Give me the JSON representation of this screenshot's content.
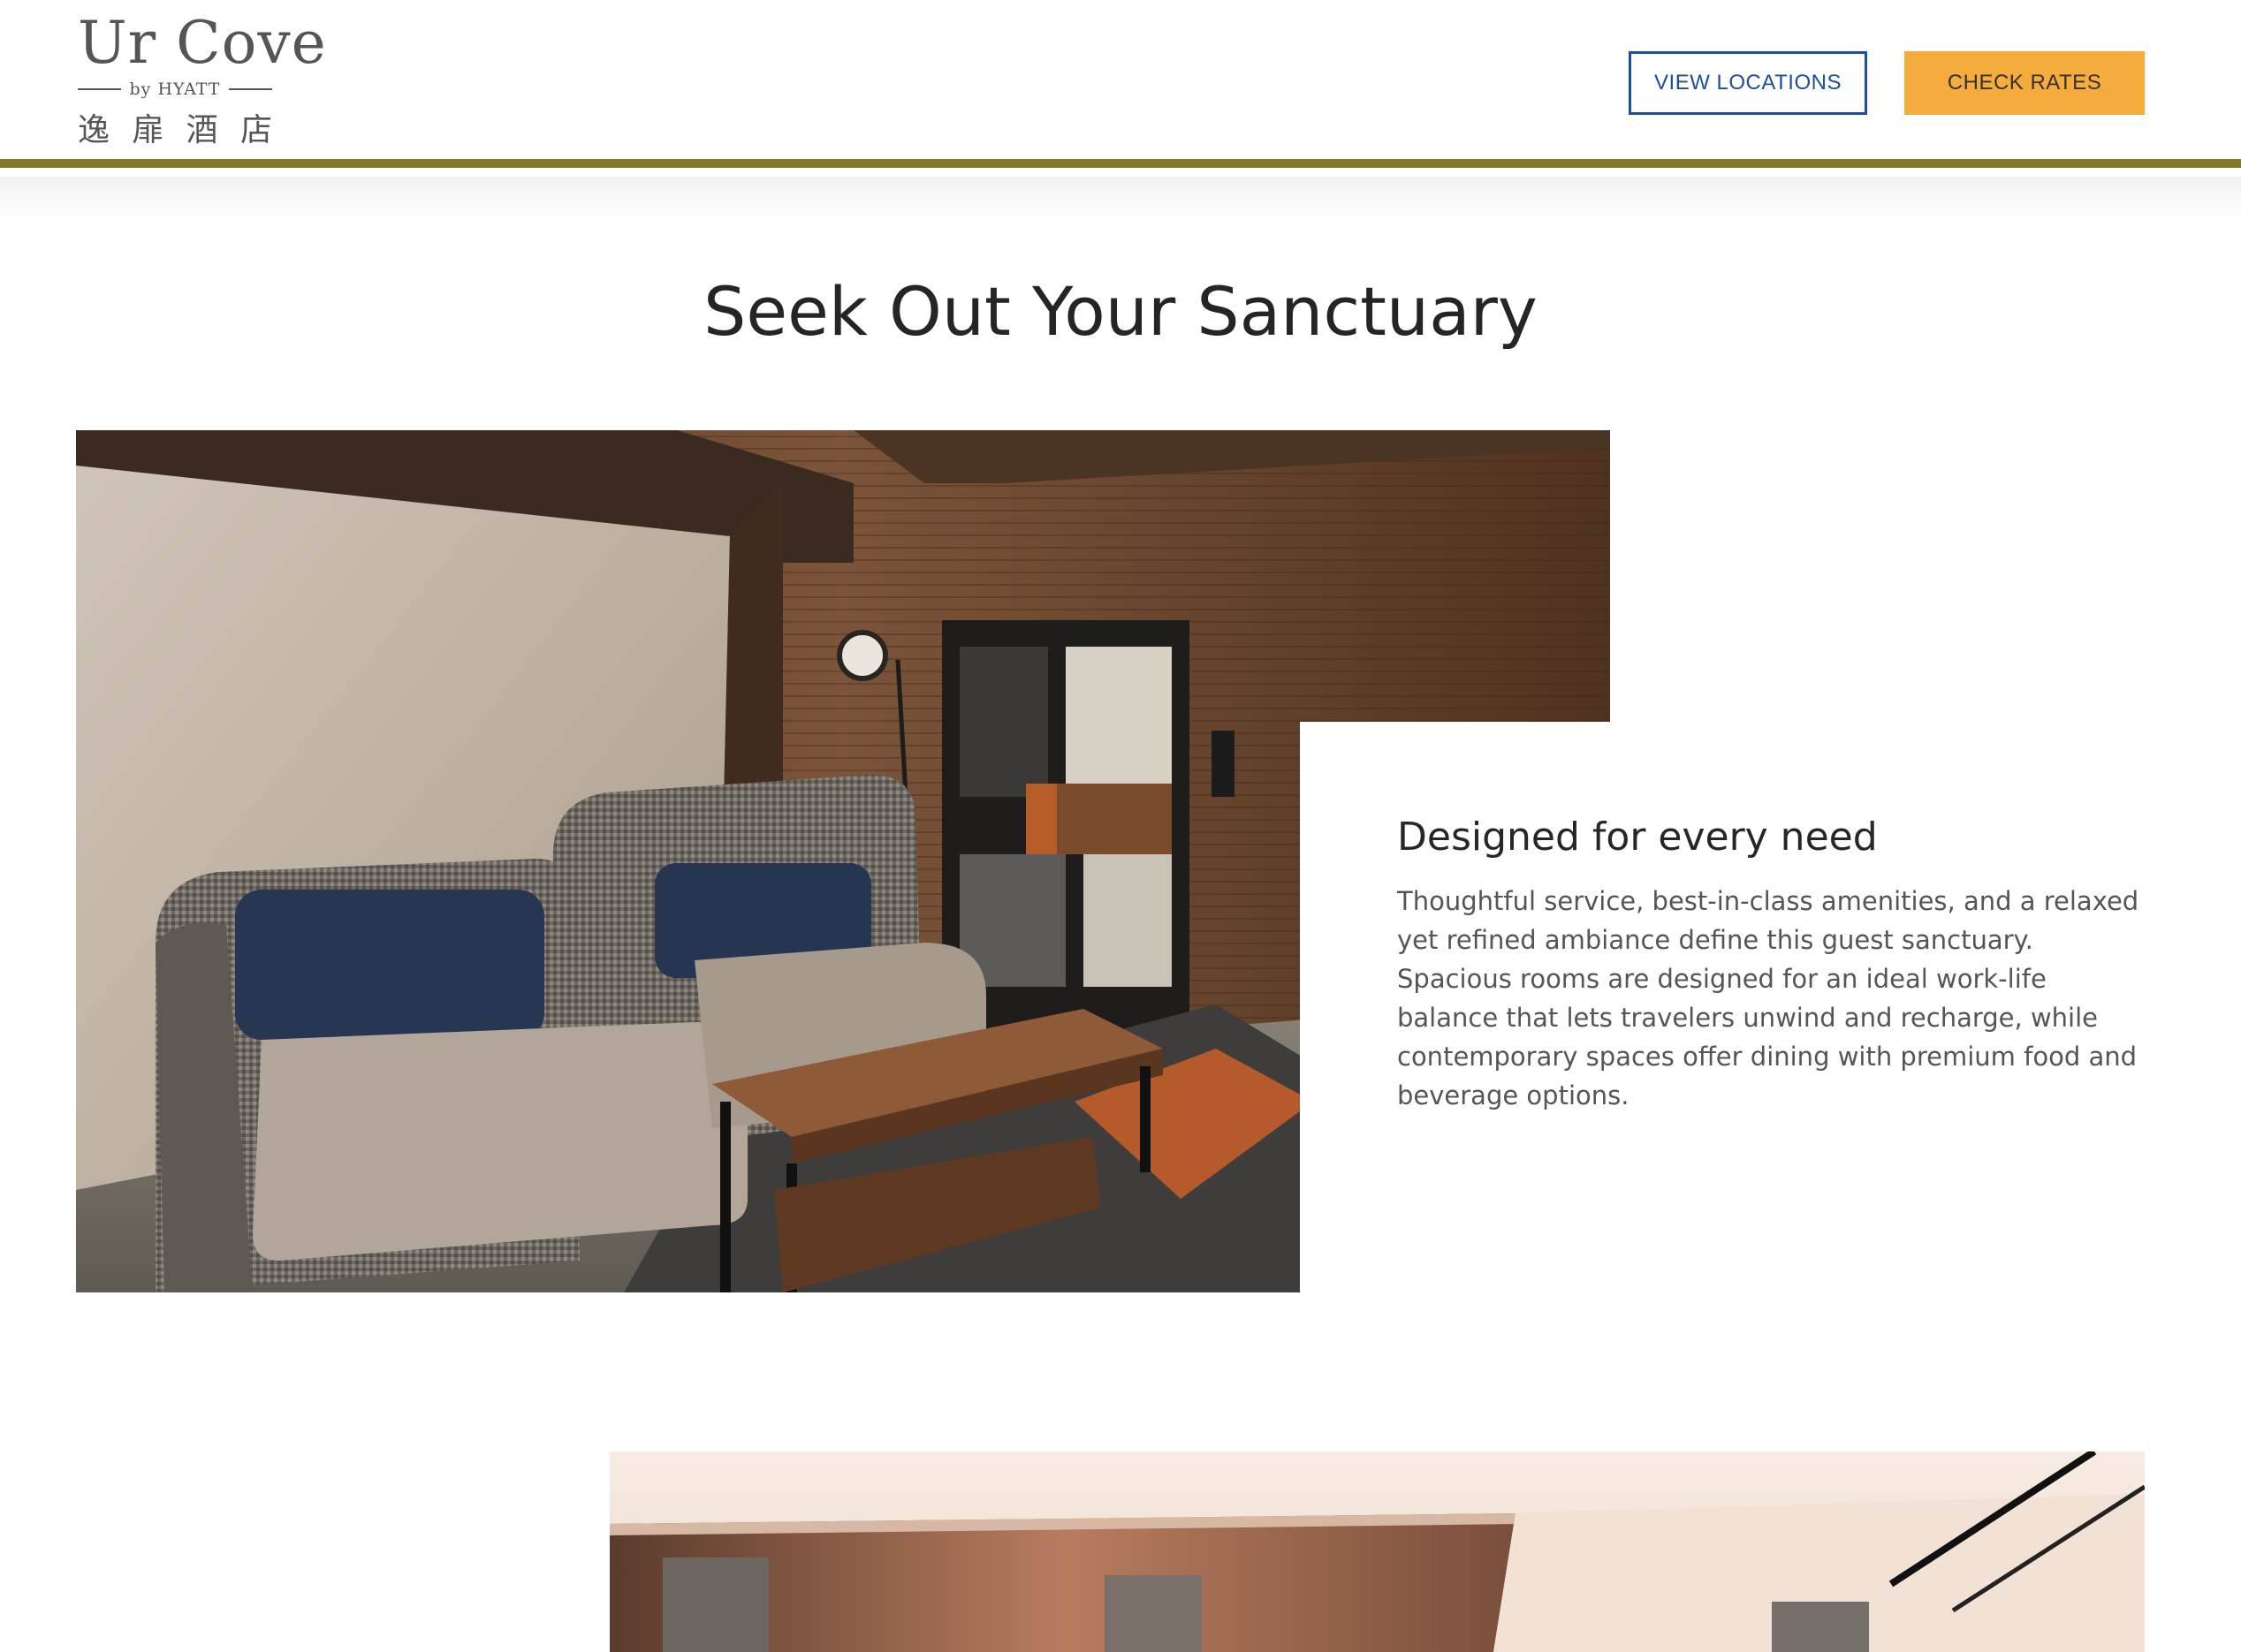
{
  "header": {
    "logo": {
      "name": "Ur Cove",
      "sub": "by HYATT",
      "cjk": [
        "逸",
        "扉",
        "酒",
        "店"
      ]
    },
    "buttons": {
      "view_locations": "VIEW LOCATIONS",
      "check_rates": "CHECK RATES"
    }
  },
  "main": {
    "title": "Seek Out Your Sanctuary",
    "feature": {
      "heading": "Designed for every need",
      "body": "Thoughtful service, best-in-class amenities, and a relaxed yet refined ambiance define this guest sanctuary. Spacious rooms are designed for an ideal work-life balance that lets travelers unwind and recharge, while contemporary spaces offer dining with premium food and beverage options."
    }
  },
  "colors": {
    "header_rule": "#857a2c",
    "outline_button": "#1d4e9a",
    "cta_button": "#f6ac3c"
  }
}
